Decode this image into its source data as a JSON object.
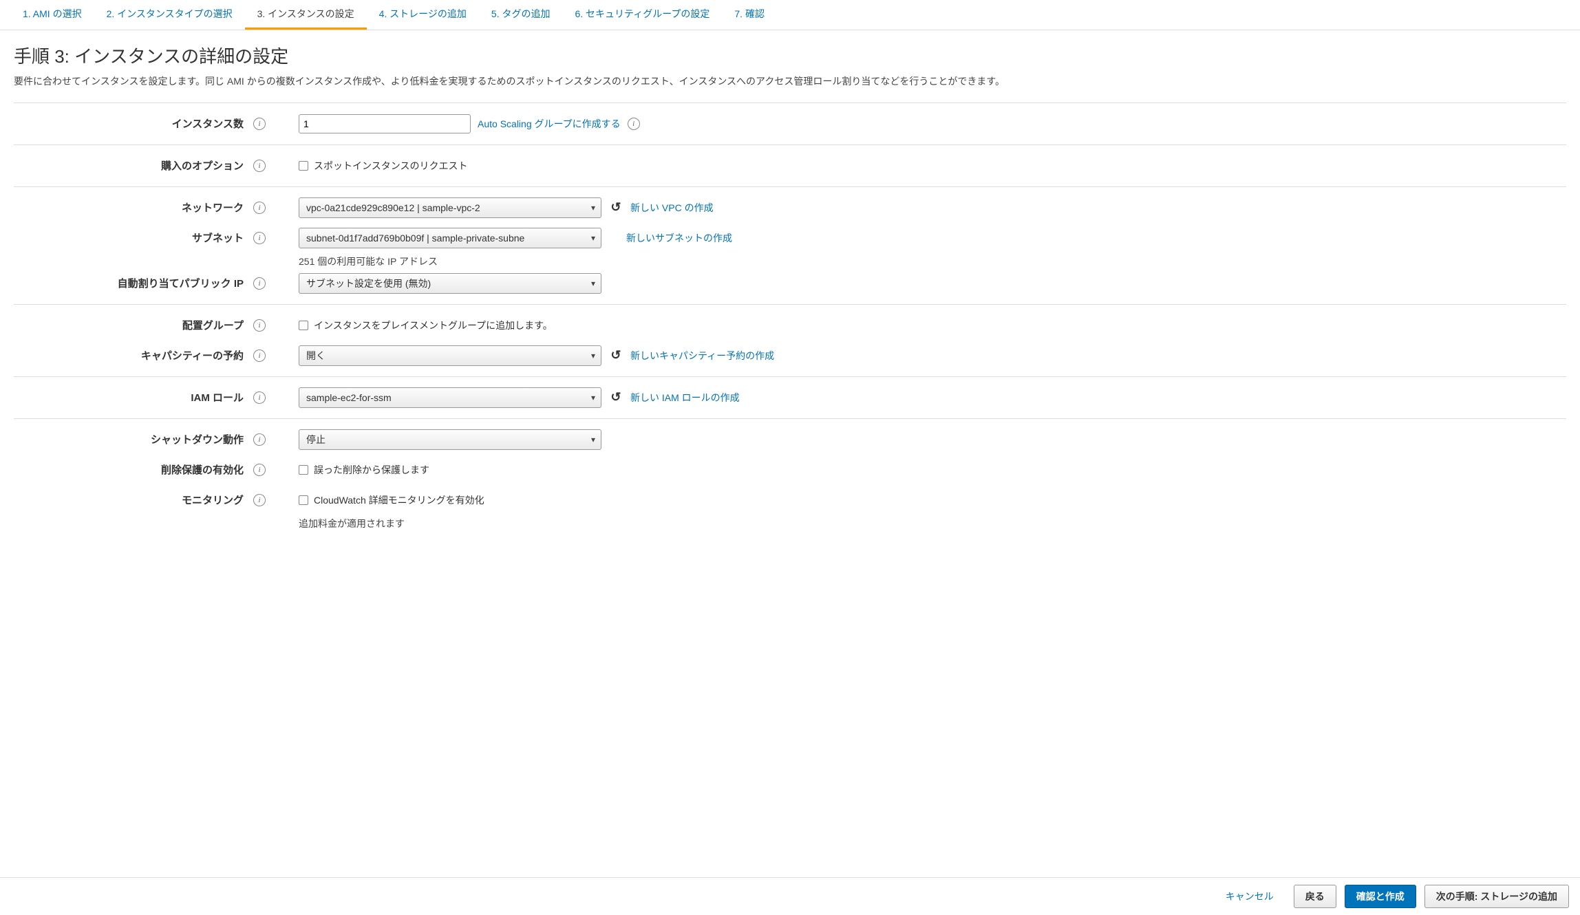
{
  "nav": {
    "step1": "1. AMI の選択",
    "step2": "2. インスタンスタイプの選択",
    "step3": "3. インスタンスの設定",
    "step4": "4. ストレージの追加",
    "step5": "5. タグの追加",
    "step6": "6. セキュリティグループの設定",
    "step7": "7. 確認"
  },
  "page": {
    "title": "手順 3: インスタンスの詳細の設定",
    "description": "要件に合わせてインスタンスを設定します。同じ AMI からの複数インスタンス作成や、より低料金を実現するためのスポットインスタンスのリクエスト、インスタンスへのアクセス管理ロール割り当てなどを行うことができます。"
  },
  "form": {
    "instances": {
      "label": "インスタンス数",
      "value": "1",
      "autoscaling_link": "Auto Scaling グループに作成する"
    },
    "purchase": {
      "label": "購入のオプション",
      "checkbox": "スポットインスタンスのリクエスト"
    },
    "network": {
      "label": "ネットワーク",
      "value": "vpc-0a21cde929c890e12 | sample-vpc-2",
      "link": "新しい VPC の作成"
    },
    "subnet": {
      "label": "サブネット",
      "value": "subnet-0d1f7add769b0b09f | sample-private-subne",
      "addresses": "251 個の利用可能な IP アドレス",
      "link": "新しいサブネットの作成"
    },
    "public_ip": {
      "label": "自動割り当てパブリック IP",
      "value": "サブネット設定を使用 (無効)"
    },
    "placement": {
      "label": "配置グループ",
      "checkbox": "インスタンスをプレイスメントグループに追加します。"
    },
    "capacity": {
      "label": "キャパシティーの予約",
      "value": "開く",
      "link": "新しいキャパシティー予約の作成"
    },
    "iam": {
      "label": "IAM ロール",
      "value": "sample-ec2-for-ssm",
      "link": "新しい IAM ロールの作成"
    },
    "shutdown": {
      "label": "シャットダウン動作",
      "value": "停止"
    },
    "delete_protect": {
      "label": "削除保護の有効化",
      "checkbox": "誤った削除から保護します"
    },
    "monitoring": {
      "label": "モニタリング",
      "checkbox": "CloudWatch 詳細モニタリングを有効化",
      "note": "追加料金が適用されます"
    }
  },
  "footer": {
    "cancel": "キャンセル",
    "back": "戻る",
    "review": "確認と作成",
    "next": "次の手順: ストレージの追加"
  }
}
